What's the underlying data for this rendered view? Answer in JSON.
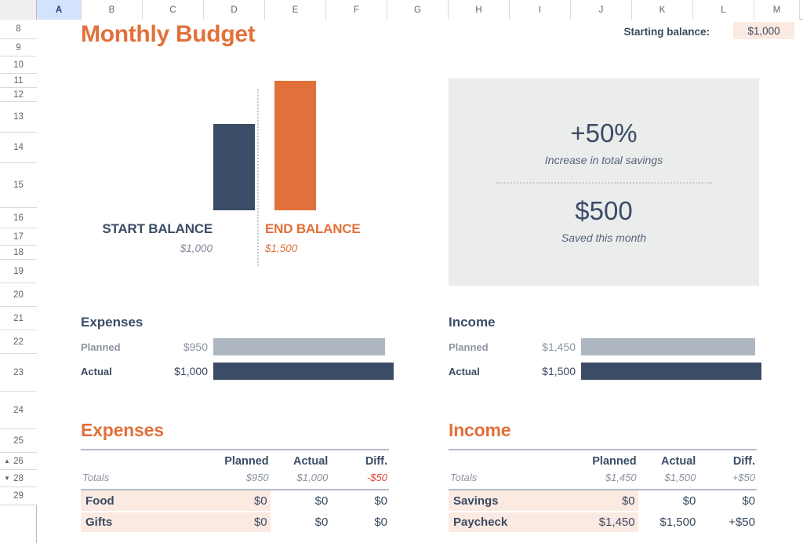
{
  "spreadsheet": {
    "columns": [
      "A",
      "B",
      "C",
      "D",
      "E",
      "F",
      "G",
      "H",
      "I",
      "J",
      "K",
      "L",
      "M"
    ],
    "active_column": "A",
    "rows": [
      "8",
      "9",
      "10",
      "11",
      "12",
      "13",
      "14",
      "15",
      "16",
      "17",
      "18",
      "19",
      "20",
      "21",
      "22",
      "23",
      "24",
      "25",
      "26",
      "28",
      "29"
    ],
    "group_toggles": {
      "row_26": "▲",
      "row_28": "▼"
    }
  },
  "header": {
    "title": "Monthly Budget",
    "starting_balance_label": "Starting balance:",
    "starting_balance_value": "$1,000"
  },
  "chart_data": {
    "type": "bar",
    "title": "",
    "categories": [
      "START BALANCE",
      "END BALANCE"
    ],
    "values": [
      1000,
      1500
    ],
    "value_labels": [
      "$1,000",
      "$1,500"
    ],
    "colors": [
      "#3b4d66",
      "#e2703a"
    ],
    "ylim": [
      0,
      1500
    ],
    "grid": false,
    "legend": "none"
  },
  "savings_panel": {
    "percent": "+50%",
    "percent_caption": "Increase in total savings",
    "amount": "$500",
    "amount_caption": "Saved this month"
  },
  "comparison": [
    {
      "heading": "Expenses",
      "rows": [
        {
          "label": "Planned",
          "amount": "$950",
          "value": 950,
          "bar_pct": 95.0
        },
        {
          "label": "Actual",
          "amount": "$1,000",
          "value": 1000,
          "bar_pct": 100.0
        }
      ]
    },
    {
      "heading": "Income",
      "rows": [
        {
          "label": "Planned",
          "amount": "$1,450",
          "value": 1450,
          "bar_pct": 96.7
        },
        {
          "label": "Actual",
          "amount": "$1,500",
          "value": 1500,
          "bar_pct": 100.0
        }
      ]
    }
  ],
  "tables": [
    {
      "heading": "Expenses",
      "columns": [
        "",
        "Planned",
        "Actual",
        "Diff."
      ],
      "totals": {
        "label": "Totals",
        "planned": "$950",
        "actual": "$1,000",
        "diff": "-$50",
        "diff_negative": true
      },
      "items": [
        {
          "name": "Food",
          "planned": "$0",
          "actual": "$0",
          "diff": "$0"
        },
        {
          "name": "Gifts",
          "planned": "$0",
          "actual": "$0",
          "diff": "$0"
        }
      ]
    },
    {
      "heading": "Income",
      "columns": [
        "",
        "Planned",
        "Actual",
        "Diff."
      ],
      "totals": {
        "label": "Totals",
        "planned": "$1,450",
        "actual": "$1,500",
        "diff": "+$50",
        "diff_negative": false
      },
      "items": [
        {
          "name": "Savings",
          "planned": "$0",
          "actual": "$0",
          "diff": "$0"
        },
        {
          "name": "Paycheck",
          "planned": "$1,450",
          "actual": "$1,500",
          "diff": "+$50"
        }
      ]
    }
  ],
  "colors": {
    "accent_orange": "#e2703a",
    "navy": "#3b4d66",
    "gray_bar": "#aeb6c2",
    "peach": "#fbeae2",
    "panel_bg": "#ebecec",
    "negative_red": "#e0443a"
  }
}
